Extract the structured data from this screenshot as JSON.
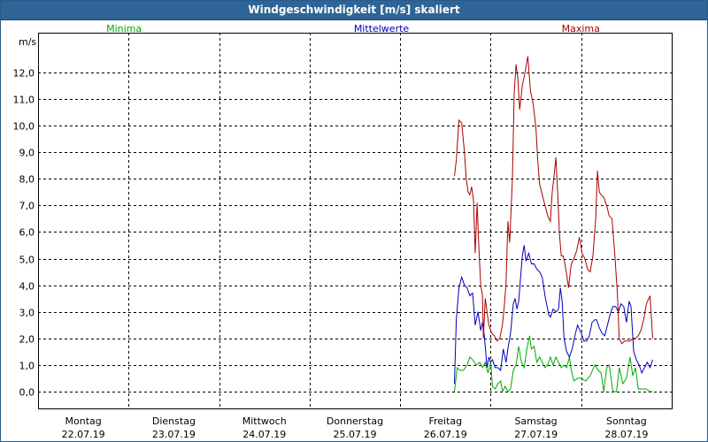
{
  "window": {
    "title": "Windgeschwindigkeit [m/s] skaliert"
  },
  "chart_data": {
    "type": "line",
    "title": "Windgeschwindigkeit [m/s] skaliert",
    "ylabel": "m/s",
    "ylim": [
      -0.4,
      13.25
    ],
    "yticks": [
      {
        "v": 0,
        "label": "0,0"
      },
      {
        "v": 1,
        "label": "1,0"
      },
      {
        "v": 2,
        "label": "2,0"
      },
      {
        "v": 3,
        "label": "3,0"
      },
      {
        "v": 4,
        "label": "4,0"
      },
      {
        "v": 5,
        "label": "5,0"
      },
      {
        "v": 6,
        "label": "6,0"
      },
      {
        "v": 7,
        "label": "7,0"
      },
      {
        "v": 8,
        "label": "8,0"
      },
      {
        "v": 9,
        "label": "9,0"
      },
      {
        "v": 10,
        "label": "10,0"
      },
      {
        "v": 11,
        "label": "11,0"
      },
      {
        "v": 12,
        "label": "12,0"
      }
    ],
    "xlim": [
      0,
      7
    ],
    "xticks": [
      {
        "day": "Montag",
        "date": "22.07.19"
      },
      {
        "day": "Dienstag",
        "date": "23.07.19"
      },
      {
        "day": "Mittwoch",
        "date": "24.07.19"
      },
      {
        "day": "Donnerstag",
        "date": "25.07.19"
      },
      {
        "day": "Freitag",
        "date": "26.07.19"
      },
      {
        "day": "Samstag",
        "date": "27.07.19"
      },
      {
        "day": "Sonntag",
        "date": "28.07.19"
      }
    ],
    "grid": true,
    "legend_position": "top",
    "series": [
      {
        "name": "Minima",
        "color": "#00aa00",
        "points": [
          [
            4.6,
            0.0
          ],
          [
            4.63,
            0.9
          ],
          [
            4.66,
            0.8
          ],
          [
            4.7,
            0.8
          ],
          [
            4.74,
            1.0
          ],
          [
            4.77,
            1.3
          ],
          [
            4.8,
            1.2
          ],
          [
            4.84,
            1.0
          ],
          [
            4.88,
            1.1
          ],
          [
            4.91,
            0.9
          ],
          [
            4.94,
            1.1
          ],
          [
            4.97,
            0.7
          ],
          [
            5.0,
            1.1
          ],
          [
            5.02,
            0.2
          ],
          [
            5.05,
            0.1
          ],
          [
            5.08,
            0.3
          ],
          [
            5.11,
            0.4
          ],
          [
            5.13,
            0.0
          ],
          [
            5.16,
            0.2
          ],
          [
            5.19,
            0.0
          ],
          [
            5.22,
            0.1
          ],
          [
            5.25,
            0.8
          ],
          [
            5.28,
            1.0
          ],
          [
            5.31,
            1.7
          ],
          [
            5.34,
            1.1
          ],
          [
            5.37,
            0.9
          ],
          [
            5.4,
            1.6
          ],
          [
            5.43,
            2.1
          ],
          [
            5.45,
            1.6
          ],
          [
            5.48,
            1.7
          ],
          [
            5.51,
            1.1
          ],
          [
            5.54,
            1.3
          ],
          [
            5.57,
            1.1
          ],
          [
            5.6,
            0.9
          ],
          [
            5.63,
            1.0
          ],
          [
            5.66,
            1.3
          ],
          [
            5.69,
            1.0
          ],
          [
            5.72,
            1.3
          ],
          [
            5.75,
            1.1
          ],
          [
            5.78,
            0.9
          ],
          [
            5.81,
            1.0
          ],
          [
            5.84,
            0.9
          ],
          [
            5.87,
            1.3
          ],
          [
            5.89,
            0.8
          ],
          [
            5.92,
            0.4
          ],
          [
            5.96,
            0.5
          ],
          [
            6.0,
            0.5
          ],
          [
            6.05,
            0.4
          ],
          [
            6.1,
            0.6
          ],
          [
            6.15,
            1.0
          ],
          [
            6.19,
            0.8
          ],
          [
            6.22,
            0.7
          ],
          [
            6.25,
            0.0
          ],
          [
            6.28,
            0.9
          ],
          [
            6.31,
            1.0
          ],
          [
            6.35,
            0.0
          ],
          [
            6.39,
            0.0
          ],
          [
            6.42,
            0.9
          ],
          [
            6.46,
            0.3
          ],
          [
            6.5,
            0.5
          ],
          [
            6.54,
            1.3
          ],
          [
            6.57,
            0.6
          ],
          [
            6.6,
            0.9
          ],
          [
            6.63,
            0.1
          ],
          [
            6.67,
            0.1
          ],
          [
            6.72,
            0.1
          ],
          [
            6.76,
            0.0
          ],
          [
            6.79,
            0.0
          ]
        ]
      },
      {
        "name": "Mittelwerte",
        "color": "#0000bb",
        "points": [
          [
            4.6,
            0.3
          ],
          [
            4.62,
            2.7
          ],
          [
            4.65,
            3.9
          ],
          [
            4.68,
            4.3
          ],
          [
            4.71,
            4.0
          ],
          [
            4.74,
            3.9
          ],
          [
            4.77,
            3.6
          ],
          [
            4.8,
            3.7
          ],
          [
            4.83,
            2.5
          ],
          [
            4.86,
            3.0
          ],
          [
            4.89,
            2.3
          ],
          [
            4.91,
            2.6
          ],
          [
            4.93,
            2.1
          ],
          [
            4.96,
            0.9
          ],
          [
            4.98,
            1.3
          ],
          [
            5.0,
            1.1
          ],
          [
            5.02,
            1.2
          ],
          [
            5.05,
            0.9
          ],
          [
            5.08,
            0.9
          ],
          [
            5.11,
            0.8
          ],
          [
            5.14,
            1.6
          ],
          [
            5.17,
            1.1
          ],
          [
            5.19,
            1.6
          ],
          [
            5.22,
            2.2
          ],
          [
            5.25,
            3.3
          ],
          [
            5.27,
            3.5
          ],
          [
            5.29,
            3.1
          ],
          [
            5.31,
            3.4
          ],
          [
            5.35,
            5.1
          ],
          [
            5.37,
            5.5
          ],
          [
            5.39,
            4.9
          ],
          [
            5.42,
            5.2
          ],
          [
            5.45,
            4.8
          ],
          [
            5.48,
            4.8
          ],
          [
            5.51,
            4.6
          ],
          [
            5.54,
            4.5
          ],
          [
            5.57,
            4.3
          ],
          [
            5.6,
            3.6
          ],
          [
            5.64,
            2.9
          ],
          [
            5.66,
            2.8
          ],
          [
            5.69,
            3.1
          ],
          [
            5.72,
            3.0
          ],
          [
            5.75,
            3.1
          ],
          [
            5.77,
            3.9
          ],
          [
            5.79,
            3.4
          ],
          [
            5.81,
            2.0
          ],
          [
            5.84,
            1.5
          ],
          [
            5.87,
            1.3
          ],
          [
            5.9,
            1.6
          ],
          [
            5.93,
            2.1
          ],
          [
            5.96,
            2.5
          ],
          [
            6.0,
            2.2
          ],
          [
            6.03,
            1.9
          ],
          [
            6.06,
            1.9
          ],
          [
            6.09,
            2.1
          ],
          [
            6.12,
            2.6
          ],
          [
            6.15,
            2.7
          ],
          [
            6.17,
            2.7
          ],
          [
            6.2,
            2.4
          ],
          [
            6.23,
            2.2
          ],
          [
            6.26,
            2.1
          ],
          [
            6.29,
            2.5
          ],
          [
            6.32,
            2.9
          ],
          [
            6.35,
            3.2
          ],
          [
            6.38,
            3.2
          ],
          [
            6.41,
            3.0
          ],
          [
            6.44,
            3.3
          ],
          [
            6.47,
            3.2
          ],
          [
            6.5,
            2.6
          ],
          [
            6.53,
            3.4
          ],
          [
            6.55,
            3.2
          ],
          [
            6.58,
            1.5
          ],
          [
            6.61,
            1.2
          ],
          [
            6.64,
            1.0
          ],
          [
            6.67,
            0.7
          ],
          [
            6.7,
            0.9
          ],
          [
            6.73,
            1.1
          ],
          [
            6.76,
            0.9
          ],
          [
            6.79,
            1.2
          ]
        ]
      },
      {
        "name": "Maxima",
        "color": "#aa0000",
        "points": [
          [
            4.6,
            8.1
          ],
          [
            4.62,
            8.7
          ],
          [
            4.65,
            10.2
          ],
          [
            4.68,
            10.1
          ],
          [
            4.71,
            9.0
          ],
          [
            4.73,
            8.0
          ],
          [
            4.75,
            7.5
          ],
          [
            4.77,
            7.4
          ],
          [
            4.79,
            7.7
          ],
          [
            4.81,
            7.2
          ],
          [
            4.83,
            5.2
          ],
          [
            4.85,
            7.1
          ],
          [
            4.87,
            5.4
          ],
          [
            4.89,
            4.0
          ],
          [
            4.91,
            3.6
          ],
          [
            4.92,
            2.0
          ],
          [
            4.94,
            3.5
          ],
          [
            4.96,
            3.0
          ],
          [
            4.98,
            2.5
          ],
          [
            5.01,
            2.2
          ],
          [
            5.04,
            2.1
          ],
          [
            5.07,
            1.9
          ],
          [
            5.1,
            2.0
          ],
          [
            5.13,
            2.5
          ],
          [
            5.15,
            3.2
          ],
          [
            5.17,
            4.1
          ],
          [
            5.19,
            6.4
          ],
          [
            5.21,
            5.6
          ],
          [
            5.24,
            8.0
          ],
          [
            5.26,
            11.2
          ],
          [
            5.28,
            12.3
          ],
          [
            5.3,
            11.8
          ],
          [
            5.32,
            10.6
          ],
          [
            5.35,
            11.5
          ],
          [
            5.38,
            12.0
          ],
          [
            5.41,
            12.6
          ],
          [
            5.44,
            11.3
          ],
          [
            5.47,
            10.8
          ],
          [
            5.5,
            9.9
          ],
          [
            5.52,
            8.7
          ],
          [
            5.54,
            7.8
          ],
          [
            5.57,
            7.4
          ],
          [
            5.6,
            7.0
          ],
          [
            5.63,
            6.6
          ],
          [
            5.66,
            6.4
          ],
          [
            5.68,
            7.5
          ],
          [
            5.7,
            8.1
          ],
          [
            5.72,
            8.8
          ],
          [
            5.74,
            7.5
          ],
          [
            5.76,
            5.9
          ],
          [
            5.78,
            5.1
          ],
          [
            5.8,
            5.1
          ],
          [
            5.82,
            4.8
          ],
          [
            5.84,
            4.4
          ],
          [
            5.86,
            3.9
          ],
          [
            5.89,
            4.8
          ],
          [
            5.92,
            5.0
          ],
          [
            5.95,
            5.3
          ],
          [
            5.98,
            5.8
          ],
          [
            6.01,
            5.2
          ],
          [
            6.04,
            5.0
          ],
          [
            6.07,
            4.6
          ],
          [
            6.1,
            4.5
          ],
          [
            6.13,
            5.1
          ],
          [
            6.16,
            6.5
          ],
          [
            6.18,
            8.3
          ],
          [
            6.2,
            7.5
          ],
          [
            6.22,
            7.4
          ],
          [
            6.25,
            7.3
          ],
          [
            6.28,
            7.0
          ],
          [
            6.31,
            6.6
          ],
          [
            6.34,
            6.5
          ],
          [
            6.37,
            5.2
          ],
          [
            6.4,
            3.7
          ],
          [
            6.42,
            2.0
          ],
          [
            6.45,
            1.8
          ],
          [
            6.48,
            1.9
          ],
          [
            6.51,
            1.9
          ],
          [
            6.54,
            1.9
          ],
          [
            6.57,
            2.0
          ],
          [
            6.6,
            2.0
          ],
          [
            6.63,
            2.1
          ],
          [
            6.66,
            2.3
          ],
          [
            6.69,
            2.7
          ],
          [
            6.72,
            3.3
          ],
          [
            6.76,
            3.6
          ],
          [
            6.79,
            2.0
          ]
        ]
      }
    ]
  }
}
